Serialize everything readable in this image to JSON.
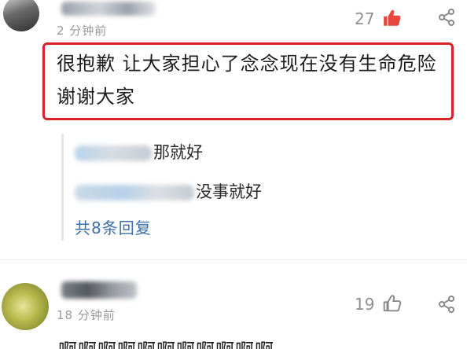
{
  "comments": [
    {
      "time": "2 分钟前",
      "likes": "27",
      "text": "很抱歉 让大家担心了念念现在没有生命危险 谢谢大家",
      "replies": [
        {
          "text": "那就好"
        },
        {
          "text": "没事就好"
        }
      ],
      "more_replies": "共8条回复",
      "liked": true
    },
    {
      "time": "18 分钟前",
      "likes": "19",
      "text": "啊啊啊啊啊啊啊啊啊啊啊",
      "liked": false
    }
  ],
  "colors": {
    "liked": "#e8453c",
    "highlight_border": "#d6242a",
    "link": "#3a6fa8",
    "meta": "#9a9a9a"
  },
  "icons": {
    "like": "thumbs-up-icon",
    "share": "share-icon"
  }
}
